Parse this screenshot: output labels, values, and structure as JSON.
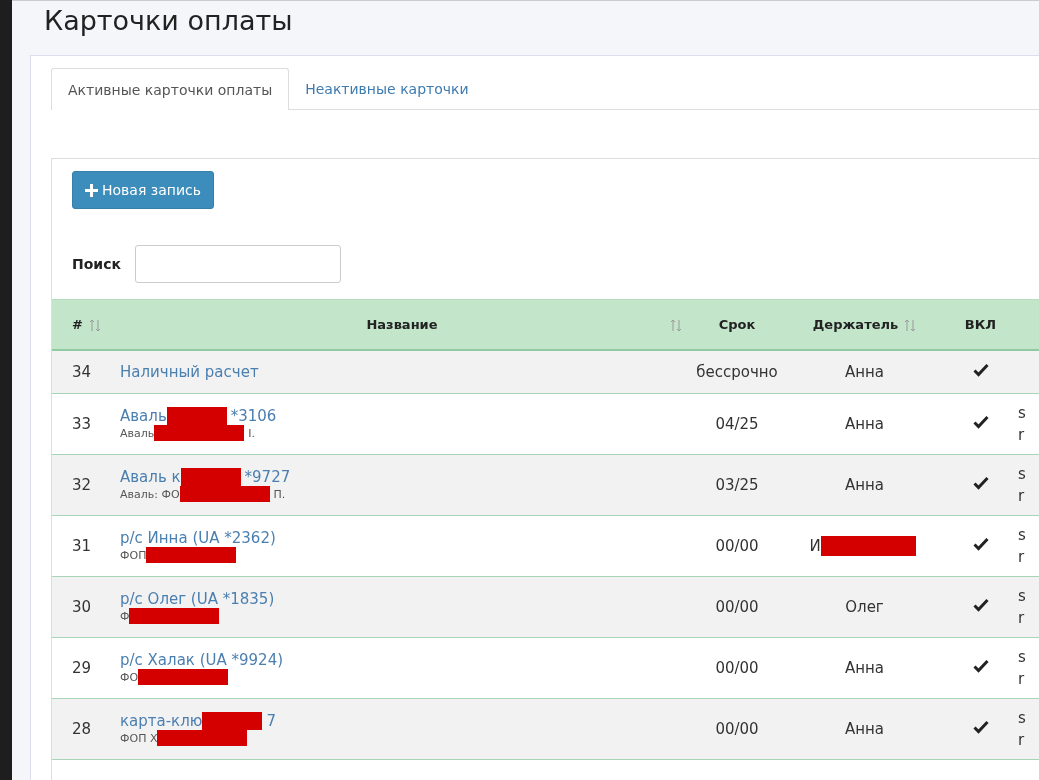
{
  "page_title": "Карточки оплаты",
  "tabs": [
    {
      "label": "Активные карточки оплаты",
      "selected": true
    },
    {
      "label": "Неактивные карточки",
      "selected": false
    }
  ],
  "new_button": "Новая запись",
  "search": {
    "label": "Поиск"
  },
  "table": {
    "columns": [
      {
        "label": "#",
        "sortable": true
      },
      {
        "label": "Название",
        "sortable": true
      },
      {
        "label": "Срок",
        "sortable": false
      },
      {
        "label": "Держатель",
        "sortable": true
      },
      {
        "label": "ВКЛ",
        "sortable": false
      }
    ],
    "rows": [
      {
        "id": "34",
        "name": {
          "parts": [
            "Наличный расчет"
          ],
          "redacted": false
        },
        "term": "бессрочно",
        "holder": {
          "parts": [
            "Анна"
          ],
          "redacted": false
        },
        "enabled": true
      },
      {
        "id": "33",
        "name": {
          "parts": [
            "Аваль",
            "*3106"
          ],
          "redacted": true
        },
        "sub": {
          "parts": [
            "Аваль",
            "I."
          ],
          "redacted": true
        },
        "term": "04/25",
        "holder": {
          "parts": [
            "Анна"
          ],
          "redacted": false
        },
        "enabled": true,
        "extra": [
          "s",
          "r"
        ]
      },
      {
        "id": "32",
        "name": {
          "parts": [
            "Аваль к",
            "*9727"
          ],
          "redacted": true
        },
        "sub": {
          "parts": [
            "Аваль: ФО",
            "П."
          ],
          "redacted": true
        },
        "term": "03/25",
        "holder": {
          "parts": [
            "Анна"
          ],
          "redacted": false
        },
        "enabled": true,
        "extra": [
          "s",
          "r"
        ]
      },
      {
        "id": "31",
        "name": {
          "parts": [
            "р/с Инна (UA *2362)"
          ],
          "redacted": false
        },
        "sub": {
          "parts": [
            "ФОП"
          ],
          "redacted": true
        },
        "term": "00/00",
        "holder": {
          "parts": [
            "И"
          ],
          "redacted": true
        },
        "enabled": true,
        "extra": [
          "s",
          "r"
        ]
      },
      {
        "id": "30",
        "name": {
          "parts": [
            "р/с Олег (UA *1835)"
          ],
          "redacted": false
        },
        "sub": {
          "parts": [
            "Ф"
          ],
          "redacted": true
        },
        "term": "00/00",
        "holder": {
          "parts": [
            "Олег"
          ],
          "redacted": false
        },
        "enabled": true,
        "extra": [
          "s",
          "r"
        ]
      },
      {
        "id": "29",
        "name": {
          "parts": [
            "р/с Халак (UA *9924)"
          ],
          "redacted": false
        },
        "sub": {
          "parts": [
            "ФО"
          ],
          "redacted": true
        },
        "term": "00/00",
        "holder": {
          "parts": [
            "Анна"
          ],
          "redacted": false
        },
        "enabled": true,
        "extra": [
          "s",
          "r"
        ]
      },
      {
        "id": "28",
        "name": {
          "parts": [
            "карта-клю",
            "7"
          ],
          "redacted": true
        },
        "sub": {
          "parts": [
            "ФОП Х"
          ],
          "redacted": true
        },
        "term": "00/00",
        "holder": {
          "parts": [
            "Анна"
          ],
          "redacted": false
        },
        "enabled": true,
        "extra": [
          "s",
          "r"
        ]
      }
    ]
  }
}
